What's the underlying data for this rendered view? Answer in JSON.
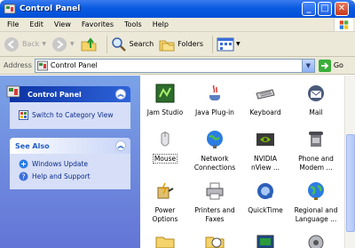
{
  "window": {
    "title": "Control Panel"
  },
  "menu": [
    "File",
    "Edit",
    "View",
    "Favorites",
    "Tools",
    "Help"
  ],
  "toolbar": {
    "back": "Back",
    "search": "Search",
    "folders": "Folders"
  },
  "address": {
    "label": "Address",
    "value": "Control Panel",
    "go": "Go"
  },
  "sidebar": {
    "panel1": {
      "title": "Control Panel",
      "link": "Switch to Category View"
    },
    "panel2": {
      "title": "See Also",
      "links": [
        "Windows Update",
        "Help and Support"
      ]
    }
  },
  "items": [
    {
      "line1": "Jam Studio",
      "line2": "",
      "icon": "jam-studio-icon"
    },
    {
      "line1": "Java Plug-in",
      "line2": "",
      "icon": "java-icon"
    },
    {
      "line1": "Keyboard",
      "line2": "",
      "icon": "keyboard-icon"
    },
    {
      "line1": "Mail",
      "line2": "",
      "icon": "mail-icon"
    },
    {
      "line1": "Mouse",
      "line2": "",
      "icon": "mouse-icon",
      "selected": true
    },
    {
      "line1": "Network",
      "line2": "Connections",
      "icon": "network-icon"
    },
    {
      "line1": "NVIDIA",
      "line2": "nView ...",
      "icon": "nvidia-icon"
    },
    {
      "line1": "Phone and",
      "line2": "Modem ...",
      "icon": "phone-icon"
    },
    {
      "line1": "Power",
      "line2": "Options",
      "icon": "power-icon"
    },
    {
      "line1": "Printers and",
      "line2": "Faxes",
      "icon": "printer-icon"
    },
    {
      "line1": "QuickTime",
      "line2": "",
      "icon": "quicktime-icon"
    },
    {
      "line1": "Regional and",
      "line2": "Language ...",
      "icon": "globe-icon"
    }
  ]
}
